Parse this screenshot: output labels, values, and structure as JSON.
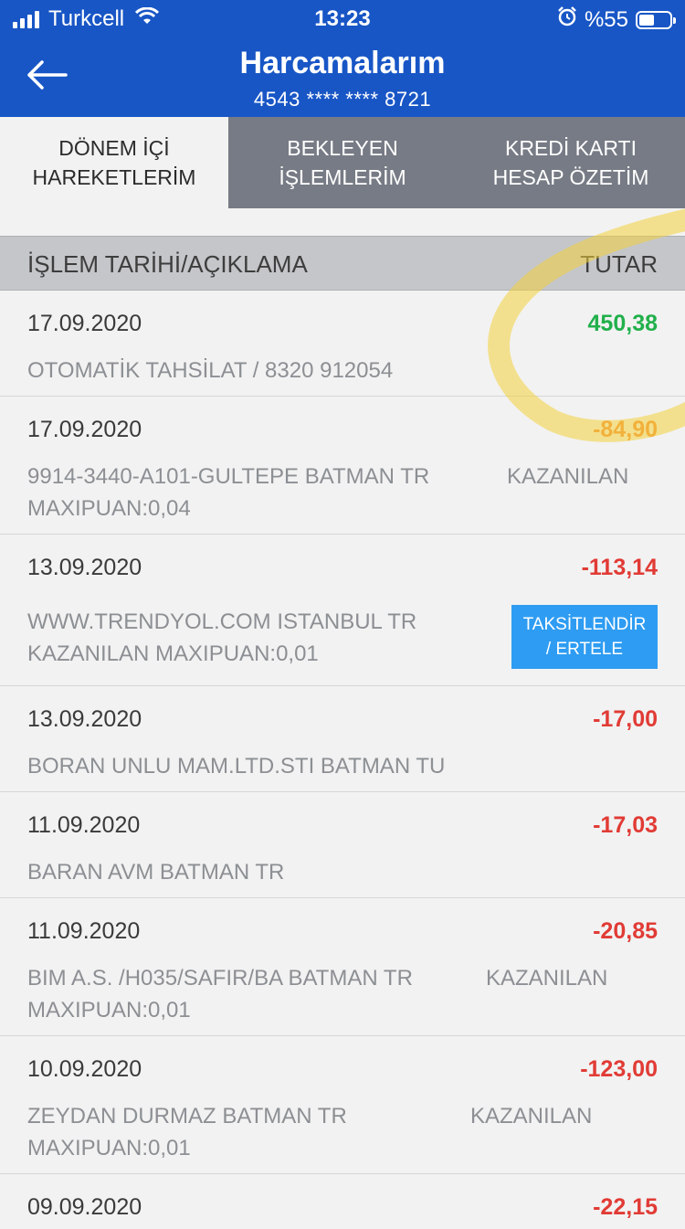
{
  "status_bar": {
    "carrier": "Turkcell",
    "time": "13:23",
    "battery": "%55"
  },
  "header": {
    "title": "Harcamalarım",
    "card_number": "4543 **** **** 8721"
  },
  "tabs": [
    {
      "label": "DÖNEM İÇİ\nHAREKETLERİM",
      "active": true
    },
    {
      "label": "BEKLEYEN\nİŞLEMLERİM",
      "active": false
    },
    {
      "label": "KREDİ KARTI\nHESAP ÖZETİM",
      "active": false
    }
  ],
  "table_header": {
    "left": "İŞLEM TARİHİ/AÇIKLAMA",
    "right": "TUTAR"
  },
  "transactions": [
    {
      "date": "17.09.2020",
      "amount": "450,38",
      "desc_1": "OTOMATİK TAHSİLAT / 8320 912054"
    },
    {
      "date": "17.09.2020",
      "amount": "-84,90",
      "desc_1": "9914-3440-A101-GULTEPE BATMAN TR",
      "desc_right": "KAZANILAN",
      "desc_2": "MAXIPUAN:0,04"
    },
    {
      "date": "13.09.2020",
      "amount": "-113,14",
      "desc_1": "WWW.TRENDYOL.COM ISTANBUL TR",
      "desc_2": "KAZANILAN MAXIPUAN:0,01",
      "action": "TAKSİTLENDİR\n/ ERTELE"
    },
    {
      "date": "13.09.2020",
      "amount": "-17,00",
      "desc_1": "BORAN UNLU MAM.LTD.STI BATMAN TU"
    },
    {
      "date": "11.09.2020",
      "amount": "-17,03",
      "desc_1": "BARAN AVM BATMAN TR"
    },
    {
      "date": "11.09.2020",
      "amount": "-20,85",
      "desc_1": "BIM A.S. /H035/SAFIR/BA BATMAN TR",
      "desc_right": "KAZANILAN",
      "desc_2": "MAXIPUAN:0,01"
    },
    {
      "date": "10.09.2020",
      "amount": "-123,00",
      "desc_1": "ZEYDAN DURMAZ BATMAN TR",
      "desc_right": "KAZANILAN",
      "desc_2": "MAXIPUAN:0,01"
    },
    {
      "date": "09.09.2020",
      "amount": "-22,15"
    }
  ],
  "colors": {
    "brand_blue": "#1856c6",
    "positive": "#21b04b",
    "negative": "#e13b35",
    "button_blue": "#2e9cf2",
    "highlight": "#f4d23c"
  }
}
